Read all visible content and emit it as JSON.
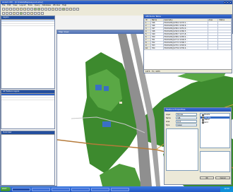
{
  "main_window": {
    "title": "Axiom MV - [C:\\Data\\Map\\Layout.amv]",
    "menu": [
      "File",
      "Edit",
      "View",
      "Layout",
      "Tools",
      "Query",
      "Database",
      "Window",
      "Help"
    ]
  },
  "map_window": {
    "title": "Map View"
  },
  "left_panels": {
    "layers_title": "Layers",
    "legend_title": "All Feature Layers",
    "overview_title": "Overview"
  },
  "table_window": {
    "title": "Attribute Table",
    "columns": [
      "ID",
      "Name",
      "Geometry",
      "Area",
      "Status"
    ],
    "rows": [
      [
        "1",
        "346",
        "POLYGON((1256.4 2233.1...",
        "",
        ""
      ],
      [
        "2",
        "346",
        "POLYGON((1258.1 2240.6...",
        "",
        ""
      ],
      [
        "3",
        "347",
        "POLYGON((1260.2 2251.0...",
        "",
        ""
      ],
      [
        "4",
        "348",
        "POLYGON((1262.9 2260.3...",
        "",
        ""
      ],
      [
        "5",
        "349",
        "POLYGON((1265.7 2271.8...",
        "",
        ""
      ],
      [
        "6",
        "350",
        "POLYGON((1268.4 2283.2...",
        "",
        ""
      ],
      [
        "7",
        "351",
        "POLYGON((1271.0 2294.5...",
        "",
        ""
      ],
      [
        "8",
        "352",
        "POLYGON((1273.3 2306.7...",
        "",
        ""
      ],
      [
        "9",
        "353",
        "POLYGON((1276.1 2318.9...",
        "",
        ""
      ],
      [
        "10",
        "354",
        "POLYGON((1279.6 2330.4...",
        "",
        ""
      ]
    ],
    "status": "1875 : 75 / 1875"
  },
  "props_window": {
    "title": "Feature Properties",
    "fields": [
      {
        "label": "Layer",
        "value": "Parcels"
      },
      {
        "label": "Name",
        "value": "346"
      },
      {
        "label": "Area",
        "value": "12.5"
      },
      {
        "label": "Type",
        "value": "Green"
      }
    ],
    "tree_items": [
      "Roads",
      "Parcels",
      "Water",
      "Grid"
    ],
    "ok_label": "OK",
    "cancel_label": "Cancel"
  },
  "taskbar": {
    "start_label": "start",
    "clock": "12:00"
  },
  "colors": {
    "map_background": "#ffffff",
    "vegetation": "#3d8a2e",
    "vegetation_light": "#5aa845",
    "road": "#8f8f8f",
    "water": "#3a6fc4"
  }
}
